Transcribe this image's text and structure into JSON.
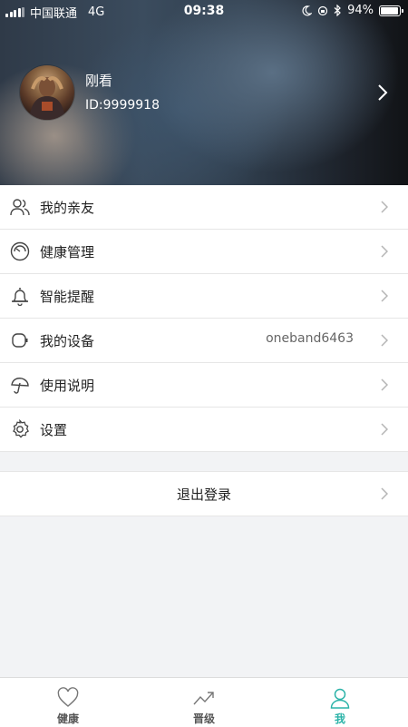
{
  "status_bar": {
    "carrier": "中国联通",
    "network": "4G",
    "time": "09:38",
    "battery": "94%",
    "battery_level": 0.94
  },
  "profile": {
    "name": "刚看",
    "id": "ID:9999918"
  },
  "menu": {
    "items": [
      {
        "label": "我的亲友",
        "icon": "friends-icon"
      },
      {
        "label": "健康管理",
        "icon": "gauge-icon"
      },
      {
        "label": "智能提醒",
        "icon": "bell-icon"
      },
      {
        "label": "我的设备",
        "icon": "watch-icon",
        "value": "oneband6463"
      },
      {
        "label": "使用说明",
        "icon": "umbrella-icon"
      },
      {
        "label": "设置",
        "icon": "gear-icon"
      }
    ]
  },
  "logout": {
    "label": "退出登录"
  },
  "tabs": [
    {
      "label": "健康",
      "icon": "heart-icon",
      "active": false
    },
    {
      "label": "晋级",
      "icon": "trend-icon",
      "active": false
    },
    {
      "label": "我",
      "icon": "person-icon",
      "active": true
    }
  ],
  "colors": {
    "accent": "#2bb3a8",
    "text": "#222222",
    "background": "#f2f3f5"
  }
}
